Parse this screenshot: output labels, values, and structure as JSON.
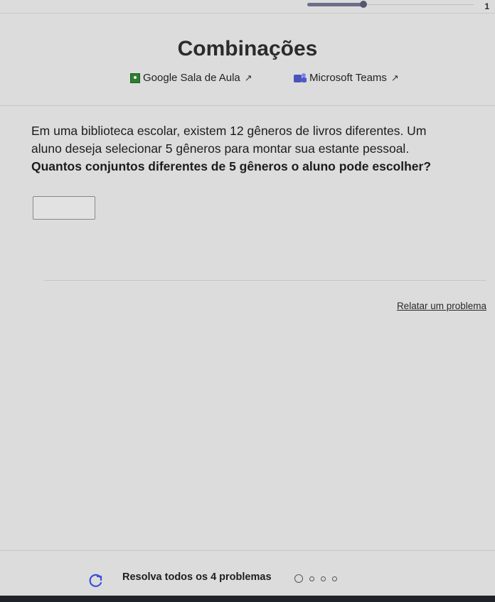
{
  "header": {
    "page_number": "1",
    "progress": 0.36
  },
  "title": "Combinações",
  "share": {
    "google_label": "Google Sala de Aula",
    "teams_label": "Microsoft Teams"
  },
  "question": {
    "line1": "Em uma biblioteca escolar, existem 12 gêneros de livros diferentes. Um",
    "line2": "aluno deseja selecionar 5 gêneros para montar sua estante pessoal.",
    "line3": "Quantos conjuntos diferentes de 5 gêneros o aluno pode escolher?"
  },
  "answer": {
    "value": ""
  },
  "report_link": "Relatar um problema",
  "footer": {
    "solve_text": "Resolva todos os 4 problemas",
    "problem_count": 4
  },
  "icons": {
    "google": "google-classroom-icon",
    "teams": "microsoft-teams-icon",
    "external": "external-link-icon",
    "refresh": "refresh-icon"
  },
  "colors": {
    "background": "#dcdcdc",
    "progress": "#6c6f8a"
  }
}
